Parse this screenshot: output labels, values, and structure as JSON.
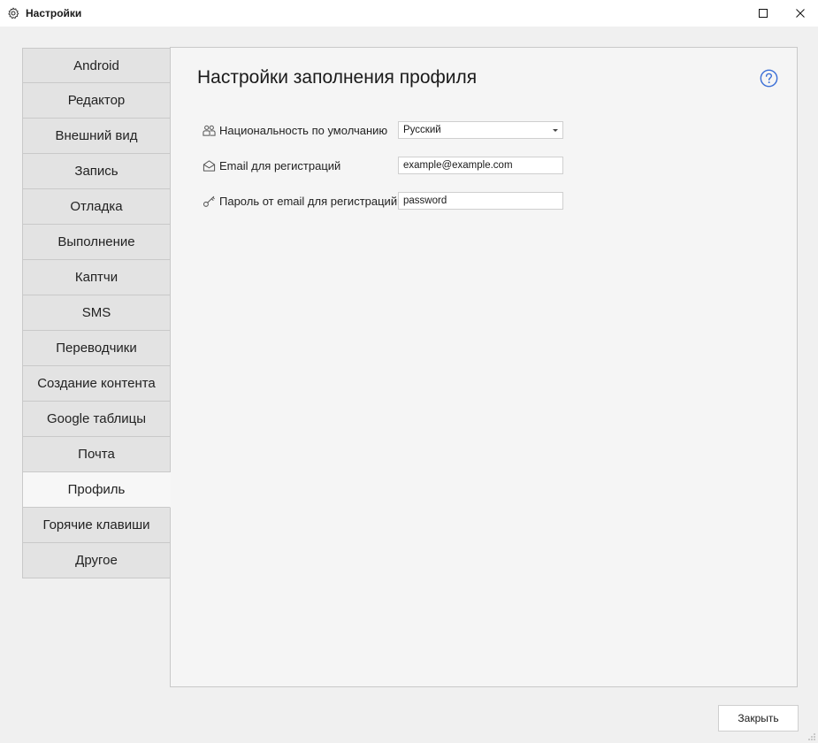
{
  "window": {
    "title": "Настройки",
    "icon": "gear-icon"
  },
  "sidebar": {
    "items": [
      {
        "label": "Android",
        "active": false
      },
      {
        "label": "Редактор",
        "active": false
      },
      {
        "label": "Внешний вид",
        "active": false
      },
      {
        "label": "Запись",
        "active": false
      },
      {
        "label": "Отладка",
        "active": false
      },
      {
        "label": "Выполнение",
        "active": false
      },
      {
        "label": "Каптчи",
        "active": false
      },
      {
        "label": "SMS",
        "active": false
      },
      {
        "label": "Переводчики",
        "active": false
      },
      {
        "label": "Создание контента",
        "active": false
      },
      {
        "label": "Google таблицы",
        "active": false
      },
      {
        "label": "Почта",
        "active": false
      },
      {
        "label": "Профиль",
        "active": true
      },
      {
        "label": "Горячие клавиши",
        "active": false
      },
      {
        "label": "Другое",
        "active": false
      }
    ]
  },
  "content": {
    "heading": "Настройки заполнения профиля",
    "help_icon": "question-circle-icon",
    "fields": {
      "nationality": {
        "label": "Национальность по умолчанию",
        "value": "Русский",
        "icon": "users-icon"
      },
      "email": {
        "label": "Email для регистраций",
        "value": "example@example.com",
        "icon": "envelope-open-icon"
      },
      "password": {
        "label": "Пароль от email для регистраций",
        "value": "password",
        "icon": "key-icon"
      }
    }
  },
  "footer": {
    "close_label": "Закрыть"
  },
  "colors": {
    "accent": "#3b6fd6",
    "nav_bg": "#e3e3e3",
    "nav_active_bg": "#f7f7f7",
    "border": "#c9c9c9"
  }
}
